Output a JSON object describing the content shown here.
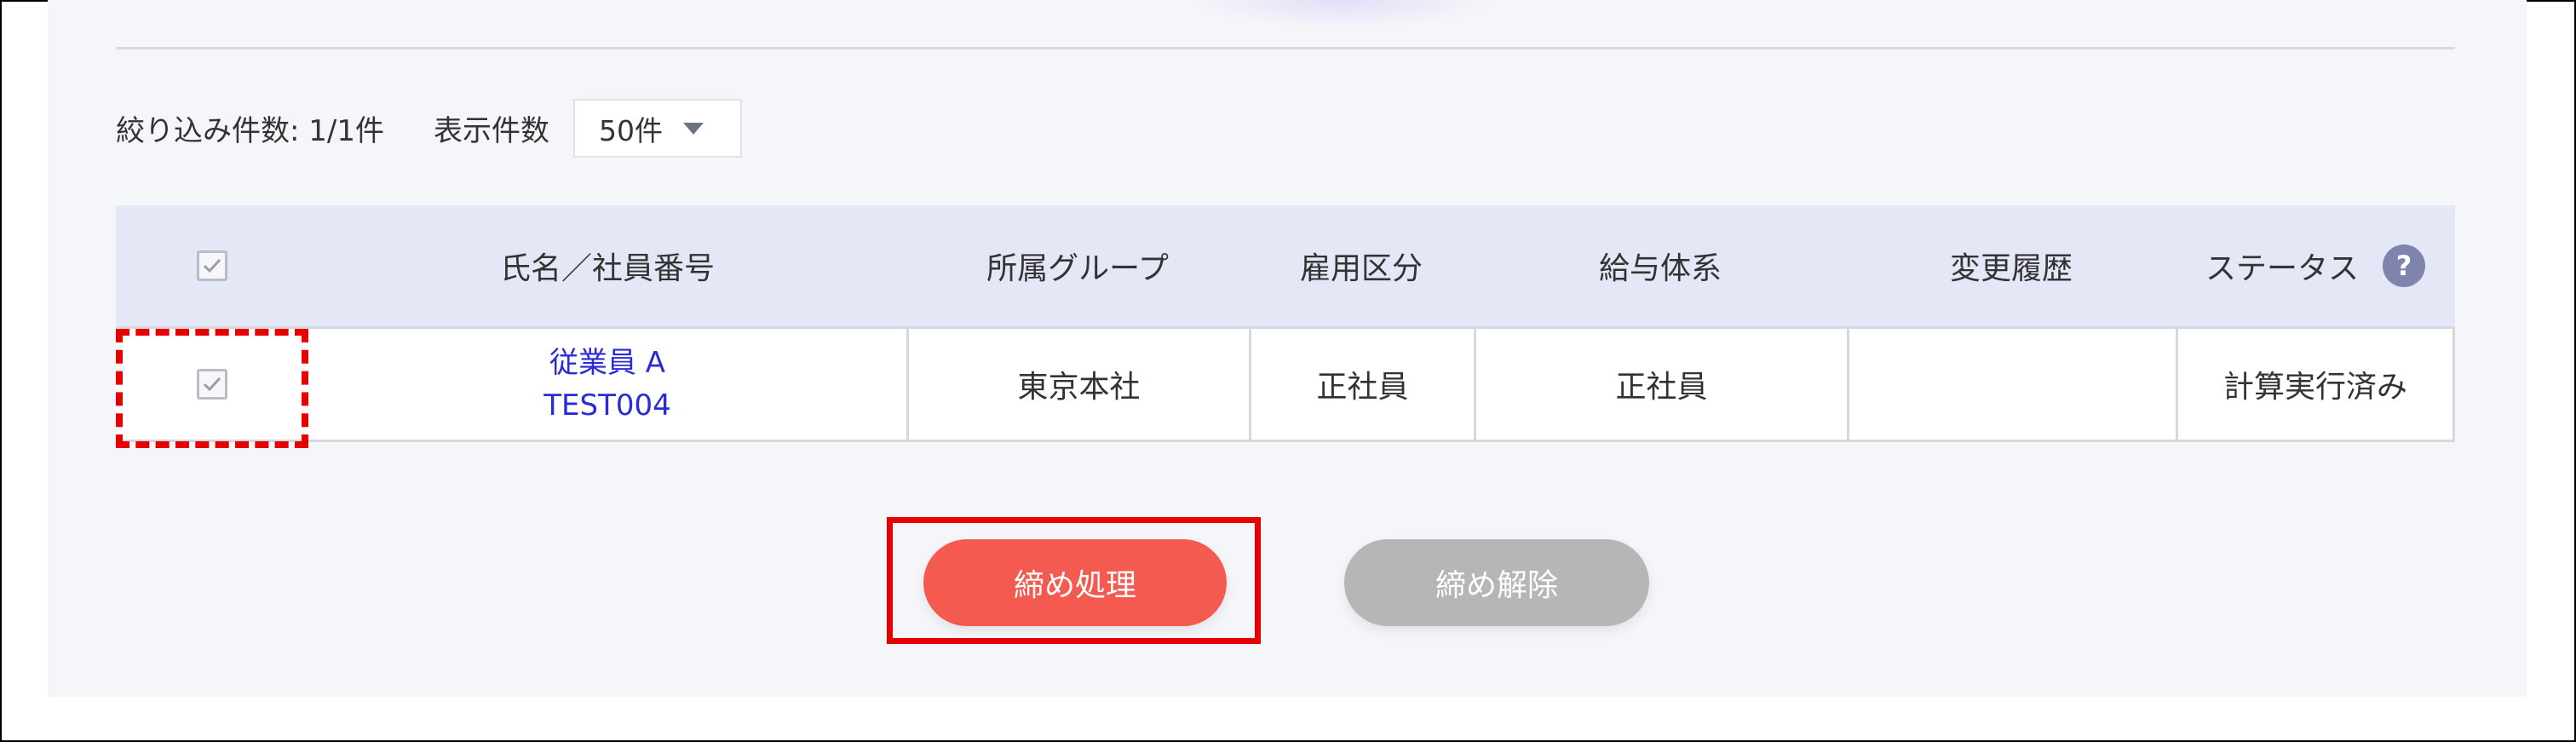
{
  "filter": {
    "filtered_count_label": "絞り込み件数: 1/1件",
    "display_count_label": "表示件数",
    "display_count_value": "50件"
  },
  "table": {
    "headers": {
      "name": "氏名／社員番号",
      "group": "所属グループ",
      "employment": "雇用区分",
      "salary": "給与体系",
      "history": "変更履歴",
      "status": "ステータス"
    },
    "help_icon": "?",
    "rows": [
      {
        "name": "従業員 A",
        "employee_no": "TEST004",
        "group": "東京本社",
        "employment": "正社員",
        "salary": "正社員",
        "history": "",
        "status": "計算実行済み",
        "checked": true
      }
    ]
  },
  "actions": {
    "close_label": "締め処理",
    "release_label": "締め解除"
  },
  "colors": {
    "header_bg": "#e4e7f5",
    "close_button": "#f45a4f",
    "release_button": "#b6b6b6",
    "link": "#2a2ad8",
    "highlight": "#e60000"
  }
}
